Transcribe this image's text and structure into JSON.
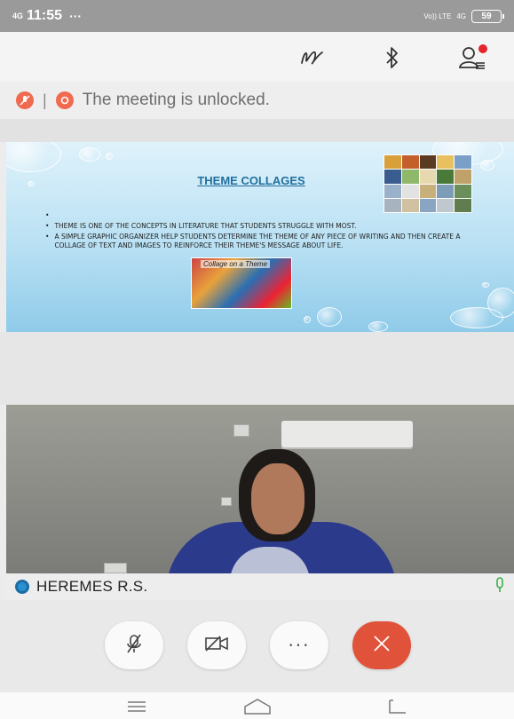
{
  "status_bar": {
    "network": "4G",
    "time": "11:55",
    "more": "···",
    "lte": "Vo)) LTE",
    "lte2": "4G",
    "battery": "59"
  },
  "meeting": {
    "lock_message": "The meeting is unlocked."
  },
  "slide": {
    "title": "THEME COLLAGES",
    "bullets": [
      "",
      "THEME IS ONE OF THE CONCEPTS IN LITERATURE THAT STUDENTS STRUGGLE WITH MOST.",
      "A SIMPLE GRAPHIC ORGANIZER HELP STUDENTS DETERMINE THE THEME OF ANY PIECE OF WRITING AND THEN CREATE A COLLAGE OF TEXT AND IMAGES TO REINFORCE THEIR THEME'S MESSAGE ABOUT LIFE."
    ],
    "collage_label": "Collage on a Theme"
  },
  "participant": {
    "name": "HEREMES R.S."
  },
  "colors": {
    "accent_red": "#e0533a",
    "accent_blue": "#1a6ea3",
    "mic_green": "#3bb04a"
  },
  "icons": {
    "toolbar": [
      "annotate-icon",
      "bluetooth-icon",
      "participants-icon"
    ],
    "controls": [
      "mic-muted-icon",
      "video-off-icon",
      "more-icon",
      "end-call-icon"
    ],
    "nav": [
      "menu-icon",
      "home-icon",
      "back-icon"
    ]
  }
}
